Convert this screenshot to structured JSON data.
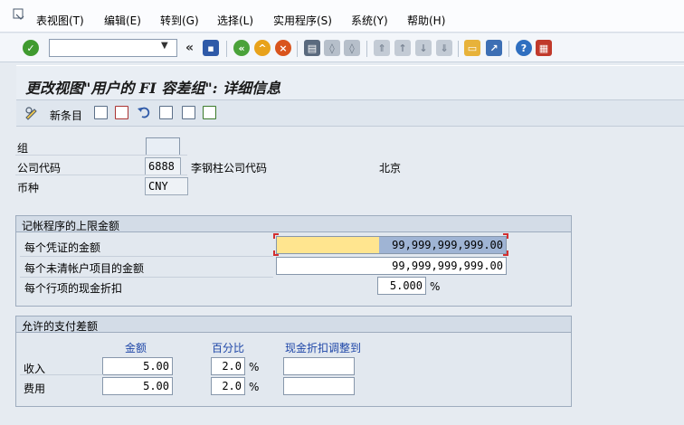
{
  "menu": {
    "items": [
      "表视图(T)",
      "编辑(E)",
      "转到(G)",
      "选择(L)",
      "实用程序(S)",
      "系统(Y)",
      "帮助(H)"
    ]
  },
  "toolbar": {
    "command_value": "",
    "back_chevron": "«",
    "icons": [
      "enter-icon",
      "save-icon",
      "back-icon",
      "exit-icon",
      "cancel-icon",
      "print-icon",
      "find-icon",
      "find-next-icon",
      "first-page-icon",
      "previous-page-icon",
      "next-page-icon",
      "last-page-icon",
      "create-session-icon",
      "shortcut-icon",
      "help-icon",
      "customize-layout-icon"
    ]
  },
  "title": "更改视图\"用户的 FI 容差组\": 详细信息",
  "app_toolbar": {
    "new_entries": "新条目"
  },
  "header": {
    "group_label": "组",
    "group_value": "",
    "company_code_label": "公司代码",
    "company_code_value": "6888",
    "company_name": "李钢柱公司代码",
    "city": "北京",
    "currency_label": "币种",
    "currency_value": "CNY"
  },
  "posting_limits": {
    "title": "记帐程序的上限金额",
    "rows": [
      {
        "label": "每个凭证的金额",
        "value": "99,999,999,999.00"
      },
      {
        "label": "每个未清帐户项目的金额",
        "value": "99,999,999,999.00"
      },
      {
        "label": "每个行项的现金折扣",
        "value": "5.000",
        "unit": "%"
      }
    ]
  },
  "payment_diff": {
    "title": "允许的支付差额",
    "col_amount": "金额",
    "col_percent": "百分比",
    "col_discount": "现金折扣调整到",
    "percent_unit": "%",
    "rows": [
      {
        "label": "收入",
        "amount": "5.00",
        "percent": "2.0",
        "discount": ""
      },
      {
        "label": "费用",
        "amount": "5.00",
        "percent": "2.0",
        "discount": ""
      }
    ]
  },
  "colors": {
    "highlight_field": "#ffe58f",
    "column_header": "#1f47a8",
    "focus_bracket": "#d32f2f"
  }
}
